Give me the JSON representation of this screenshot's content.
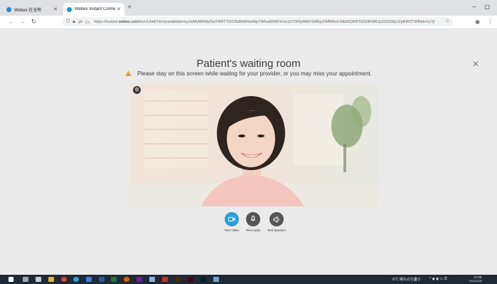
{
  "browser": {
    "tabs": [
      {
        "title": "Webex 在全所",
        "active": false
      },
      {
        "title": "Webex Instant Connect",
        "active": true
      }
    ],
    "url": "https://instant.webex.com/hc/v1/talk?int=jose&data=eyJwMvMKMzZixiTRRTTiXCRd5bWSeRlpTWhsdDMSYmx1OTW3yWEFSWEpZWBtRsF2dEtDQKBTbGt3bWKJzZG52Rp1ZjdNR2TWl5tdvXyTyWMjlsw9NDgxIm1ZC8In",
    "url_highlight": "webex.com"
  },
  "page": {
    "title": "Patient's waiting room",
    "notice": "Please stay on this screen while waiting for your provider, or you may miss your appointment."
  },
  "controls": [
    {
      "label": "Test Video",
      "icon": "video-camera-icon",
      "color": "#2aa0d8"
    },
    {
      "label": "Test Audio",
      "icon": "microphone-icon",
      "color": "#555555"
    },
    {
      "label": "Test Speaker",
      "icon": "speaker-icon",
      "color": "#555555"
    }
  ],
  "taskbar": {
    "weather": "6°C 晴れのち曇り",
    "time": "17:00",
    "date": "2021/01/06"
  },
  "colors": {
    "accent": "#2aa0d8",
    "warning": "#e8a33a"
  }
}
